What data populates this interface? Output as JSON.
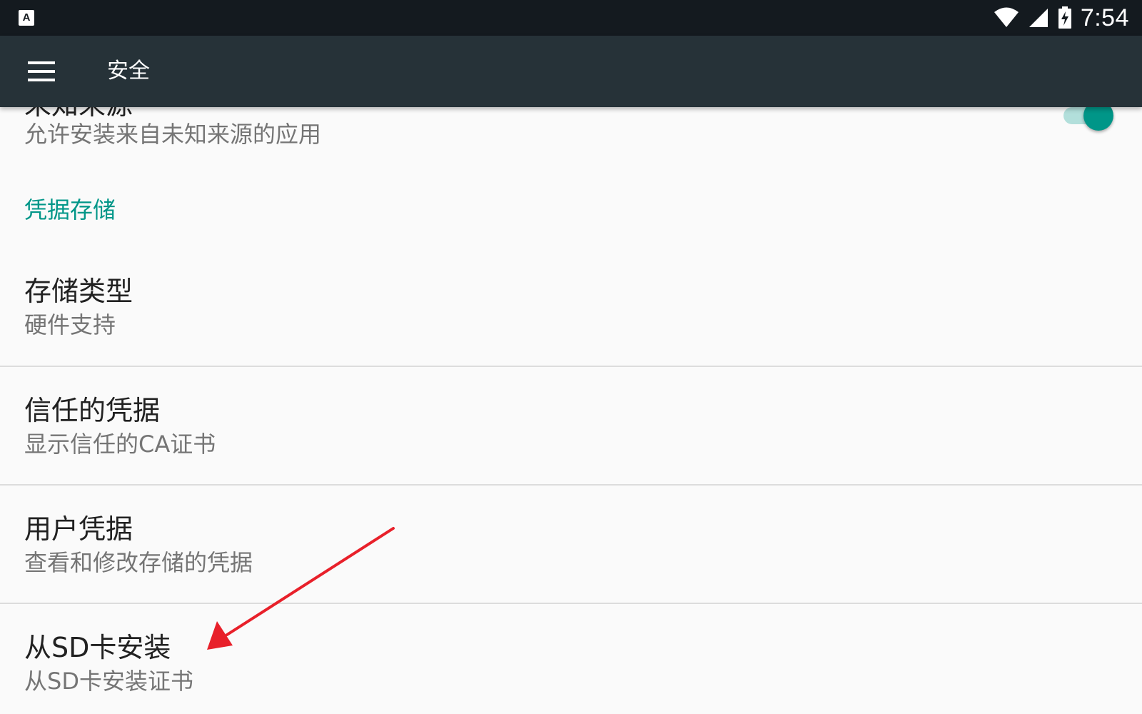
{
  "status_bar": {
    "app_icon_letter": "A",
    "time": "7:54",
    "icons": [
      "wifi-icon",
      "cell-signal-icon",
      "battery-charging-icon"
    ]
  },
  "toolbar": {
    "menu_icon": "hamburger-menu-icon",
    "title": "安全"
  },
  "items": {
    "unknown_sources": {
      "title": "未知来源",
      "summary": "允许安装来自未知来源的应用",
      "switch_on": true
    },
    "category": {
      "title": "凭据存储"
    },
    "storage_type": {
      "title": "存储类型",
      "summary": "硬件支持"
    },
    "trusted_credentials": {
      "title": "信任的凭据",
      "summary": "显示信任的CA证书"
    },
    "user_credentials": {
      "title": "用户凭据",
      "summary": "查看和修改存储的凭据"
    },
    "install_from_sd": {
      "title": "从SD卡安装",
      "summary": "从SD卡安装证书"
    }
  },
  "colors": {
    "status_bar": "#141a1f",
    "toolbar": "#263238",
    "accent": "#009688",
    "switch_track": "#b2dfdb",
    "background": "#fafafa",
    "annotation_arrow": "#e8202a"
  }
}
